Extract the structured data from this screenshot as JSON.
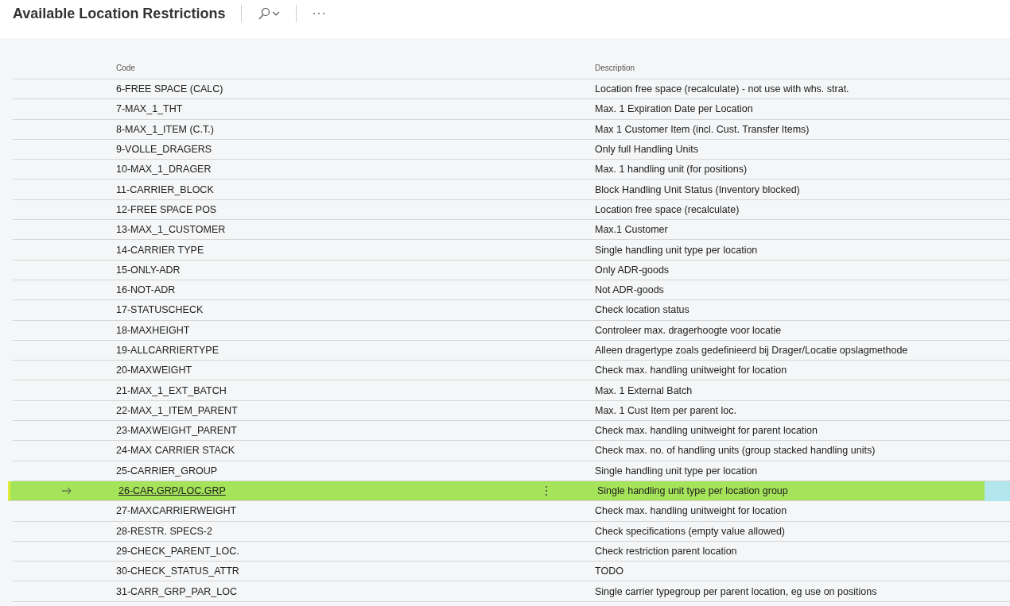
{
  "page": {
    "title": "Available Location Restrictions"
  },
  "table": {
    "columns": [
      "Code",
      "Description"
    ],
    "rows": [
      {
        "code": "6-FREE SPACE (CALC)",
        "description": "Location free space (recalculate) - not use with whs. strat.",
        "selected": false
      },
      {
        "code": "7-MAX_1_THT",
        "description": "Max. 1 Expiration Date per Location",
        "selected": false
      },
      {
        "code": "8-MAX_1_ITEM (C.T.)",
        "description": "Max 1 Customer Item (incl. Cust. Transfer Items)",
        "selected": false
      },
      {
        "code": "9-VOLLE_DRAGERS",
        "description": "Only full Handling Units",
        "selected": false
      },
      {
        "code": "10-MAX_1_DRAGER",
        "description": "Max. 1 handling unit (for positions)",
        "selected": false
      },
      {
        "code": "11-CARRIER_BLOCK",
        "description": "Block Handling Unit Status (Inventory blocked)",
        "selected": false
      },
      {
        "code": "12-FREE SPACE POS",
        "description": "Location free space (recalculate)",
        "selected": false
      },
      {
        "code": "13-MAX_1_CUSTOMER",
        "description": "Max.1 Customer",
        "selected": false
      },
      {
        "code": "14-CARRIER TYPE",
        "description": "Single handling unit type per location",
        "selected": false
      },
      {
        "code": "15-ONLY-ADR",
        "description": "Only ADR-goods",
        "selected": false
      },
      {
        "code": "16-NOT-ADR",
        "description": "Not ADR-goods",
        "selected": false
      },
      {
        "code": "17-STATUSCHECK",
        "description": "Check location status",
        "selected": false
      },
      {
        "code": "18-MAXHEIGHT",
        "description": "Controleer max. dragerhoogte voor locatie",
        "selected": false
      },
      {
        "code": "19-ALLCARRIERTYPE",
        "description": "Alleen dragertype zoals gedefinieerd bij Drager/Locatie opslagmethode",
        "selected": false
      },
      {
        "code": "20-MAXWEIGHT",
        "description": "Check max. handling unitweight for location",
        "selected": false
      },
      {
        "code": "21-MAX_1_EXT_BATCH",
        "description": "Max. 1 External Batch",
        "selected": false
      },
      {
        "code": "22-MAX_1_ITEM_PARENT",
        "description": "Max. 1 Cust Item per parent loc.",
        "selected": false
      },
      {
        "code": "23-MAXWEIGHT_PARENT",
        "description": "Check max. handling unitweight for parent location",
        "selected": false
      },
      {
        "code": "24-MAX CARRIER STACK",
        "description": "Check max. no. of handling units (group stacked handling units)",
        "selected": false
      },
      {
        "code": "25-CARRIER_GROUP",
        "description": "Single handling unit type per location",
        "selected": false
      },
      {
        "code": "26-CAR.GRP/LOC.GRP",
        "description": "Single handling unit type per location group",
        "selected": true
      },
      {
        "code": "27-MAXCARRIERWEIGHT",
        "description": "Check max. handling unitweight for location",
        "selected": false
      },
      {
        "code": "28-RESTR. SPECS-2",
        "description": "Check specifications (empty value allowed)",
        "selected": false
      },
      {
        "code": "29-CHECK_PARENT_LOC.",
        "description": "Check restriction parent location",
        "selected": false
      },
      {
        "code": "30-CHECK_STATUS_ATTR",
        "description": "TODO",
        "selected": false
      },
      {
        "code": "31-CARR_GRP_PAR_LOC",
        "description": "Single carrier typegroup per parent location, eg use on positions",
        "selected": false
      }
    ]
  }
}
